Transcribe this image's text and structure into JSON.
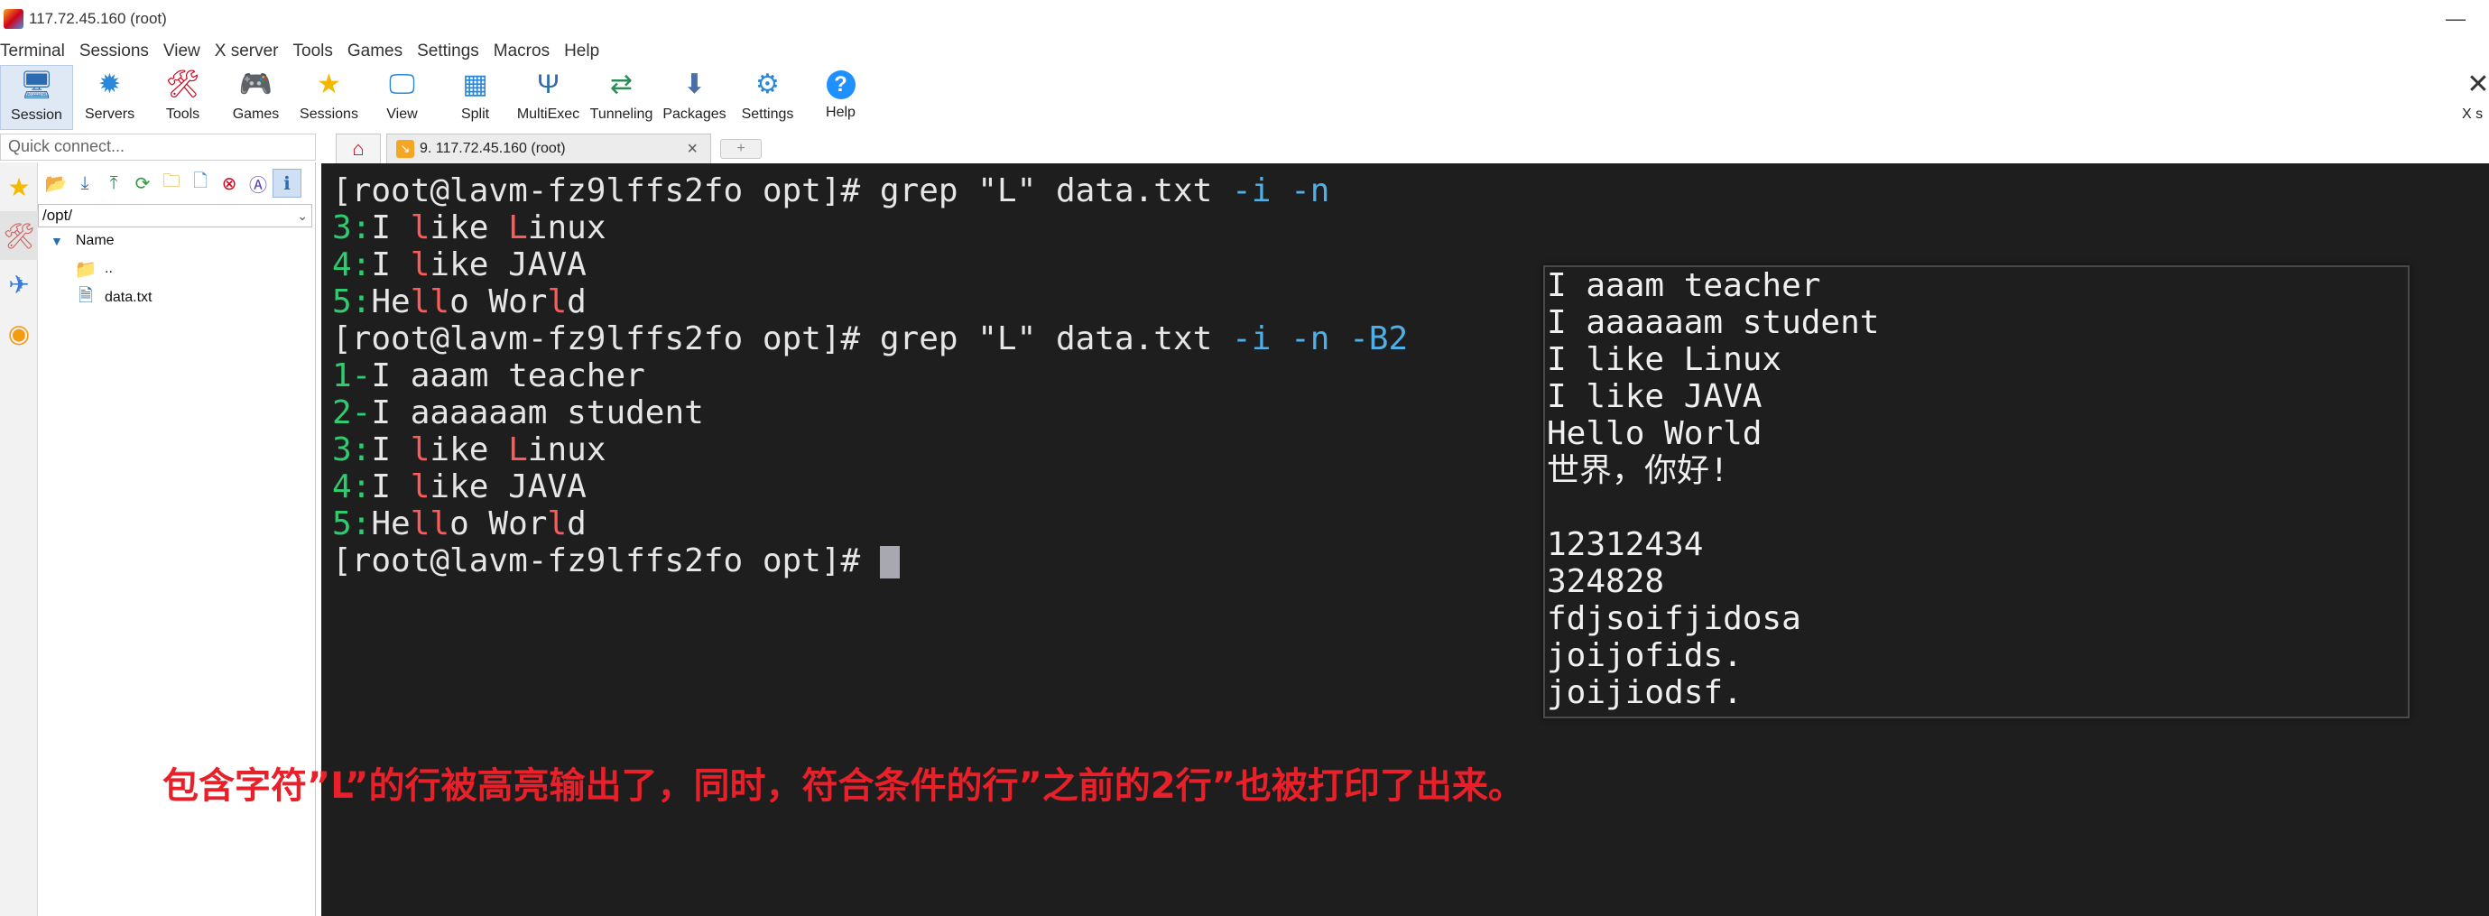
{
  "window": {
    "title": "117.72.45.160 (root)",
    "minimize_glyph": "—"
  },
  "menu": [
    "Terminal",
    "Sessions",
    "View",
    "X server",
    "Tools",
    "Games",
    "Settings",
    "Macros",
    "Help"
  ],
  "toolbar": [
    {
      "label": "Session",
      "icon": "session-icon",
      "glyph": "🖥",
      "color": "#2b6cb0",
      "active": true
    },
    {
      "label": "Servers",
      "icon": "servers-icon",
      "glyph": "✹",
      "color": "#2b88d8"
    },
    {
      "label": "Tools",
      "icon": "tools-icon",
      "glyph": "🛠",
      "color": "#d0021b"
    },
    {
      "label": "Games",
      "icon": "games-icon",
      "glyph": "🎮",
      "color": "#555555"
    },
    {
      "label": "Sessions",
      "icon": "star-icon",
      "glyph": "★",
      "color": "#f5b800"
    },
    {
      "label": "View",
      "icon": "view-icon",
      "glyph": "🖵",
      "color": "#2b88d8"
    },
    {
      "label": "Split",
      "icon": "split-icon",
      "glyph": "▦",
      "color": "#2b88d8"
    },
    {
      "label": "MultiExec",
      "icon": "multiexec-icon",
      "glyph": "Ψ",
      "color": "#2b6cb0"
    },
    {
      "label": "Tunneling",
      "icon": "tunneling-icon",
      "glyph": "⇄",
      "color": "#2e8b57"
    },
    {
      "label": "Packages",
      "icon": "packages-icon",
      "glyph": "⬇",
      "color": "#4a6fa5"
    },
    {
      "label": "Settings",
      "icon": "settings-icon",
      "glyph": "⚙",
      "color": "#2b88d8"
    },
    {
      "label": "Help",
      "icon": "help-icon",
      "glyph": "?",
      "color": "#1e90ff"
    }
  ],
  "xserver_label": "X s",
  "quick_connect_placeholder": "Quick connect...",
  "tabs": {
    "session_tab": "9. 117.72.45.160 (root)",
    "close_glyph": "×",
    "new_glyph": "+"
  },
  "sftp": {
    "path": "/opt/",
    "column": "Name",
    "items": [
      {
        "name": "..",
        "icon": "parent-folder-icon"
      },
      {
        "name": "data.txt",
        "icon": "text-file-icon"
      }
    ]
  },
  "terminal": {
    "prompt": "[root@lavm-fz9lffs2fo opt]# ",
    "cmd1": {
      "base": "grep \"L\" data.txt ",
      "opt_i": "-i",
      "opt_n": "-n"
    },
    "cmd2": {
      "base": "grep \"L\" data.txt ",
      "opt_i": "-i",
      "opt_n": "-n",
      "opt_b": "-B2"
    },
    "out1": [
      {
        "num": "3:",
        "pre": "I ",
        "hl1": "l",
        "mid": "ike ",
        "hl2": "L",
        "post": "inux"
      },
      {
        "num": "4:",
        "pre": "I ",
        "hl1": "l",
        "mid": "ike JAVA",
        "hl2": "",
        "post": ""
      },
      {
        "num": "5:",
        "pre": "He",
        "hl1": "ll",
        "mid": "o Wor",
        "hl2": "l",
        "post": "d"
      }
    ],
    "ctx": [
      {
        "num": "1-",
        "text": "I aaam teacher"
      },
      {
        "num": "2-",
        "text": "I aaaaaam student"
      }
    ]
  },
  "file_content": [
    "I aaam teacher",
    "I aaaaaam student",
    "I like Linux",
    "I like JAVA",
    "Hello World",
    "世界，你好!",
    "",
    "12312434",
    "324828",
    "fdjsoifjidosa",
    "joijofids.",
    "joijiodsf."
  ],
  "caption": "包含字符”L”的行被高亮输出了，同时，符合条件的行”之前的2行”也被打印了出来。"
}
